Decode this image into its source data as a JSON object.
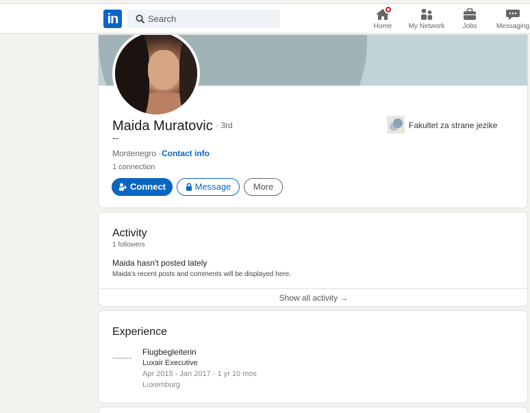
{
  "nav": {
    "search_placeholder": "Search",
    "items": [
      {
        "label": "Home",
        "icon": "home-icon"
      },
      {
        "label": "My Network",
        "icon": "network-icon"
      },
      {
        "label": "Jobs",
        "icon": "briefcase-icon"
      },
      {
        "label": "Messaging",
        "icon": "messaging-icon"
      }
    ]
  },
  "profile": {
    "name": "Maida Muratovic",
    "degree": "· 3rd",
    "headline": "--",
    "location": "Montenegro ·",
    "contact_info": "Contact info",
    "connections": "1 connection",
    "education": "Fakultet za strane jezike",
    "buttons": {
      "connect": "Connect",
      "message": "Message",
      "more": "More"
    }
  },
  "activity": {
    "title": "Activity",
    "followers": "1 followers",
    "empty_title": "Maida hasn't posted lately",
    "empty_sub": "Maida's recent posts and comments will be displayed here.",
    "show_all": "Show all activity →"
  },
  "experience": {
    "title": "Experience",
    "items": [
      {
        "logo_text": "LUXAIR EXECUTIVE",
        "role": "Flugbegleiterin",
        "company": "Luxair Executive",
        "dates": "Apr 2015 - Jan 2017 · 1 yr 10 mos",
        "location": "Luxemburg"
      }
    ]
  },
  "colors": {
    "brand": "#0a66c2",
    "notification": "#cc1016",
    "background": "#f3f2ef"
  }
}
